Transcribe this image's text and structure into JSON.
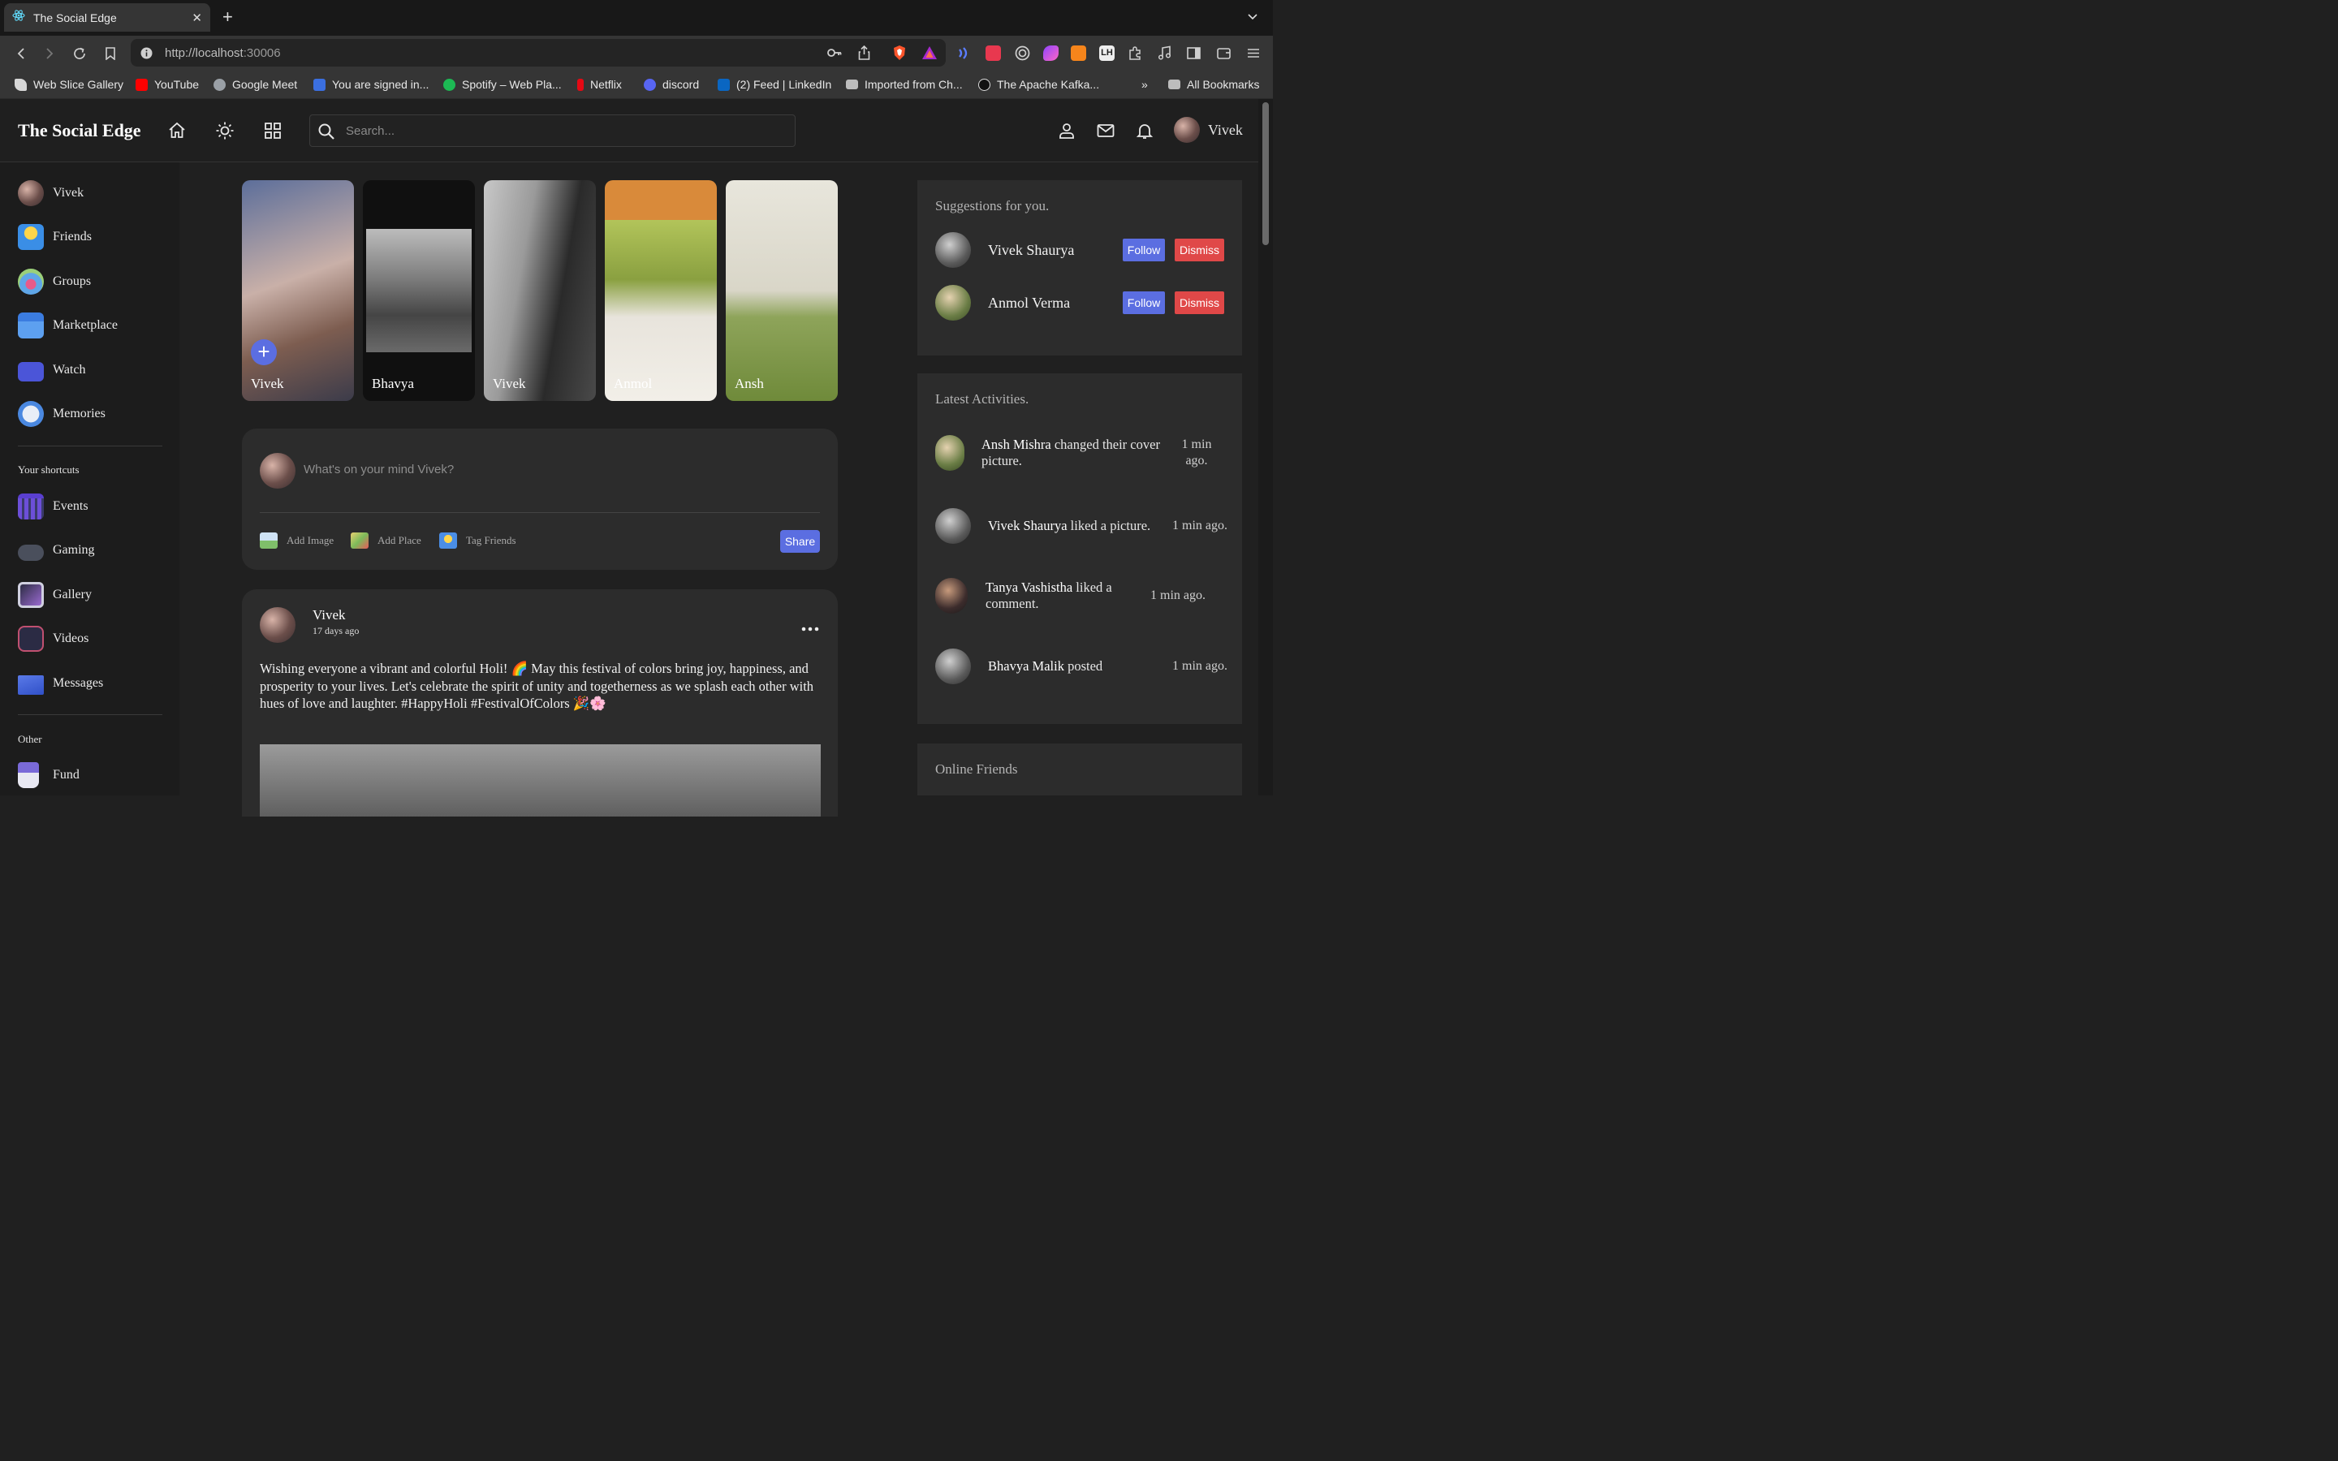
{
  "browser": {
    "tab_title": "The Social Edge",
    "url_host": "http://localhost",
    "url_port": ":30006"
  },
  "bookmarks": [
    {
      "label": "Web Slice Gallery",
      "icon": "leaf-icon",
      "color": "#e8e8e8"
    },
    {
      "label": "YouTube",
      "icon": "youtube-icon",
      "color": "#ff0000"
    },
    {
      "label": "Google Meet",
      "icon": "globe-icon",
      "color": "#9aa0a6"
    },
    {
      "label": "You are signed in...",
      "icon": "s-icon",
      "color": "#3b6fe0"
    },
    {
      "label": "Spotify – Web Pla...",
      "icon": "spotify-icon",
      "color": "#1db954"
    },
    {
      "label": "Netflix",
      "icon": "netflix-icon",
      "color": "#e50914"
    },
    {
      "label": "discord",
      "icon": "discord-icon",
      "color": "#5865f2"
    },
    {
      "label": "(2) Feed | LinkedIn",
      "icon": "linkedin-icon",
      "color": "#0a66c2"
    },
    {
      "label": "Imported from Ch...",
      "icon": "folder-icon",
      "color": "#bdbdbd"
    },
    {
      "label": "The Apache Kafka...",
      "icon": "kafka-icon",
      "color": "#e8e8e8"
    },
    {
      "label": "All Bookmarks",
      "icon": "folder-icon",
      "color": "#bdbdbd"
    }
  ],
  "app": {
    "logo": "The Social Edge",
    "search_placeholder": "Search...",
    "user_name": "Vivek"
  },
  "sidebar": {
    "main": [
      {
        "label": "Vivek",
        "icon": "avatar"
      },
      {
        "label": "Friends",
        "icon": "friends-icon"
      },
      {
        "label": "Groups",
        "icon": "groups-icon"
      },
      {
        "label": "Marketplace",
        "icon": "marketplace-icon"
      },
      {
        "label": "Watch",
        "icon": "watch-icon"
      },
      {
        "label": "Memories",
        "icon": "memories-icon"
      }
    ],
    "shortcuts_heading": "Your shortcuts",
    "shortcuts": [
      {
        "label": "Events",
        "icon": "calendar-icon"
      },
      {
        "label": "Gaming",
        "icon": "gamepad-icon"
      },
      {
        "label": "Gallery",
        "icon": "gallery-icon"
      },
      {
        "label": "Videos",
        "icon": "videos-icon"
      },
      {
        "label": "Messages",
        "icon": "messages-icon"
      }
    ],
    "other_heading": "Other",
    "other": [
      {
        "label": "Fund",
        "icon": "fund-icon"
      }
    ]
  },
  "stories": [
    {
      "name": "Vivek",
      "add": true
    },
    {
      "name": "Bhavya"
    },
    {
      "name": "Vivek"
    },
    {
      "name": "Anmol"
    },
    {
      "name": "Ansh"
    }
  ],
  "composer": {
    "placeholder": "What's on your mind Vivek?",
    "add_image": "Add Image",
    "add_place": "Add Place",
    "tag_friends": "Tag Friends",
    "share": "Share"
  },
  "post": {
    "author": "Vivek",
    "time": "17 days ago",
    "text": "Wishing everyone a vibrant and colorful Holi! 🌈 May this festival of colors bring joy, happiness, and prosperity to your lives. Let's celebrate the spirit of unity and togetherness as we splash each other with hues of love and laughter. #HappyHoli #FestivalOfColors 🎉🌸"
  },
  "suggestions": {
    "title": "Suggestions for you.",
    "follow_label": "Follow",
    "dismiss_label": "Dismiss",
    "items": [
      {
        "name": "Vivek Shaurya"
      },
      {
        "name": "Anmol Verma"
      }
    ]
  },
  "activities": {
    "title": "Latest Activities.",
    "items": [
      {
        "user": "Ansh Mishra",
        "action": " changed their cover picture.",
        "time": "1 min ago."
      },
      {
        "user": "Vivek Shaurya",
        "action": " liked a picture.",
        "time": "1 min ago."
      },
      {
        "user": "Tanya Vashistha",
        "action": " liked a comment.",
        "time": "1 min ago."
      },
      {
        "user": "Bhavya Malik",
        "action": " posted",
        "time": "1 min ago."
      }
    ]
  },
  "online": {
    "title": "Online Friends"
  }
}
